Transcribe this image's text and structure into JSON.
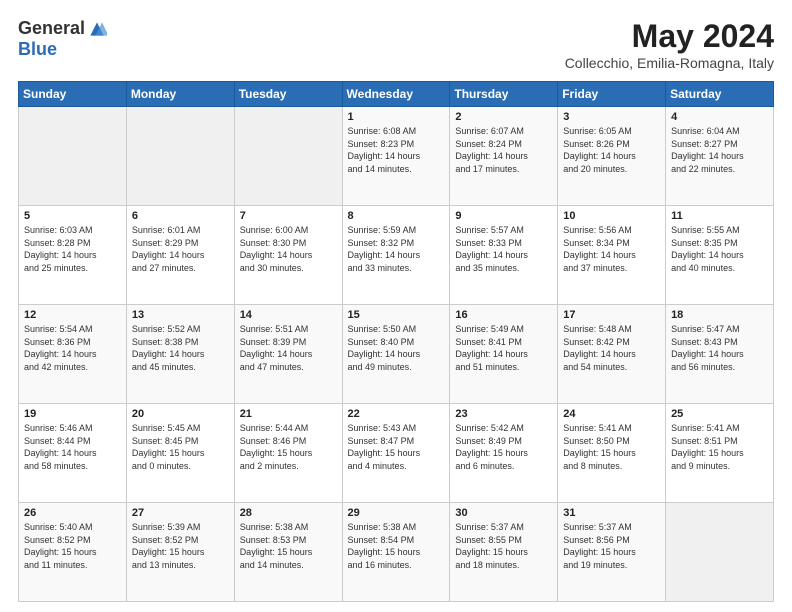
{
  "header": {
    "logo_general": "General",
    "logo_blue": "Blue",
    "month_title": "May 2024",
    "subtitle": "Collecchio, Emilia-Romagna, Italy"
  },
  "weekdays": [
    "Sunday",
    "Monday",
    "Tuesday",
    "Wednesday",
    "Thursday",
    "Friday",
    "Saturday"
  ],
  "weeks": [
    [
      {
        "day": "",
        "info": ""
      },
      {
        "day": "",
        "info": ""
      },
      {
        "day": "",
        "info": ""
      },
      {
        "day": "1",
        "info": "Sunrise: 6:08 AM\nSunset: 8:23 PM\nDaylight: 14 hours\nand 14 minutes."
      },
      {
        "day": "2",
        "info": "Sunrise: 6:07 AM\nSunset: 8:24 PM\nDaylight: 14 hours\nand 17 minutes."
      },
      {
        "day": "3",
        "info": "Sunrise: 6:05 AM\nSunset: 8:26 PM\nDaylight: 14 hours\nand 20 minutes."
      },
      {
        "day": "4",
        "info": "Sunrise: 6:04 AM\nSunset: 8:27 PM\nDaylight: 14 hours\nand 22 minutes."
      }
    ],
    [
      {
        "day": "5",
        "info": "Sunrise: 6:03 AM\nSunset: 8:28 PM\nDaylight: 14 hours\nand 25 minutes."
      },
      {
        "day": "6",
        "info": "Sunrise: 6:01 AM\nSunset: 8:29 PM\nDaylight: 14 hours\nand 27 minutes."
      },
      {
        "day": "7",
        "info": "Sunrise: 6:00 AM\nSunset: 8:30 PM\nDaylight: 14 hours\nand 30 minutes."
      },
      {
        "day": "8",
        "info": "Sunrise: 5:59 AM\nSunset: 8:32 PM\nDaylight: 14 hours\nand 33 minutes."
      },
      {
        "day": "9",
        "info": "Sunrise: 5:57 AM\nSunset: 8:33 PM\nDaylight: 14 hours\nand 35 minutes."
      },
      {
        "day": "10",
        "info": "Sunrise: 5:56 AM\nSunset: 8:34 PM\nDaylight: 14 hours\nand 37 minutes."
      },
      {
        "day": "11",
        "info": "Sunrise: 5:55 AM\nSunset: 8:35 PM\nDaylight: 14 hours\nand 40 minutes."
      }
    ],
    [
      {
        "day": "12",
        "info": "Sunrise: 5:54 AM\nSunset: 8:36 PM\nDaylight: 14 hours\nand 42 minutes."
      },
      {
        "day": "13",
        "info": "Sunrise: 5:52 AM\nSunset: 8:38 PM\nDaylight: 14 hours\nand 45 minutes."
      },
      {
        "day": "14",
        "info": "Sunrise: 5:51 AM\nSunset: 8:39 PM\nDaylight: 14 hours\nand 47 minutes."
      },
      {
        "day": "15",
        "info": "Sunrise: 5:50 AM\nSunset: 8:40 PM\nDaylight: 14 hours\nand 49 minutes."
      },
      {
        "day": "16",
        "info": "Sunrise: 5:49 AM\nSunset: 8:41 PM\nDaylight: 14 hours\nand 51 minutes."
      },
      {
        "day": "17",
        "info": "Sunrise: 5:48 AM\nSunset: 8:42 PM\nDaylight: 14 hours\nand 54 minutes."
      },
      {
        "day": "18",
        "info": "Sunrise: 5:47 AM\nSunset: 8:43 PM\nDaylight: 14 hours\nand 56 minutes."
      }
    ],
    [
      {
        "day": "19",
        "info": "Sunrise: 5:46 AM\nSunset: 8:44 PM\nDaylight: 14 hours\nand 58 minutes."
      },
      {
        "day": "20",
        "info": "Sunrise: 5:45 AM\nSunset: 8:45 PM\nDaylight: 15 hours\nand 0 minutes."
      },
      {
        "day": "21",
        "info": "Sunrise: 5:44 AM\nSunset: 8:46 PM\nDaylight: 15 hours\nand 2 minutes."
      },
      {
        "day": "22",
        "info": "Sunrise: 5:43 AM\nSunset: 8:47 PM\nDaylight: 15 hours\nand 4 minutes."
      },
      {
        "day": "23",
        "info": "Sunrise: 5:42 AM\nSunset: 8:49 PM\nDaylight: 15 hours\nand 6 minutes."
      },
      {
        "day": "24",
        "info": "Sunrise: 5:41 AM\nSunset: 8:50 PM\nDaylight: 15 hours\nand 8 minutes."
      },
      {
        "day": "25",
        "info": "Sunrise: 5:41 AM\nSunset: 8:51 PM\nDaylight: 15 hours\nand 9 minutes."
      }
    ],
    [
      {
        "day": "26",
        "info": "Sunrise: 5:40 AM\nSunset: 8:52 PM\nDaylight: 15 hours\nand 11 minutes."
      },
      {
        "day": "27",
        "info": "Sunrise: 5:39 AM\nSunset: 8:52 PM\nDaylight: 15 hours\nand 13 minutes."
      },
      {
        "day": "28",
        "info": "Sunrise: 5:38 AM\nSunset: 8:53 PM\nDaylight: 15 hours\nand 14 minutes."
      },
      {
        "day": "29",
        "info": "Sunrise: 5:38 AM\nSunset: 8:54 PM\nDaylight: 15 hours\nand 16 minutes."
      },
      {
        "day": "30",
        "info": "Sunrise: 5:37 AM\nSunset: 8:55 PM\nDaylight: 15 hours\nand 18 minutes."
      },
      {
        "day": "31",
        "info": "Sunrise: 5:37 AM\nSunset: 8:56 PM\nDaylight: 15 hours\nand 19 minutes."
      },
      {
        "day": "",
        "info": ""
      }
    ]
  ]
}
